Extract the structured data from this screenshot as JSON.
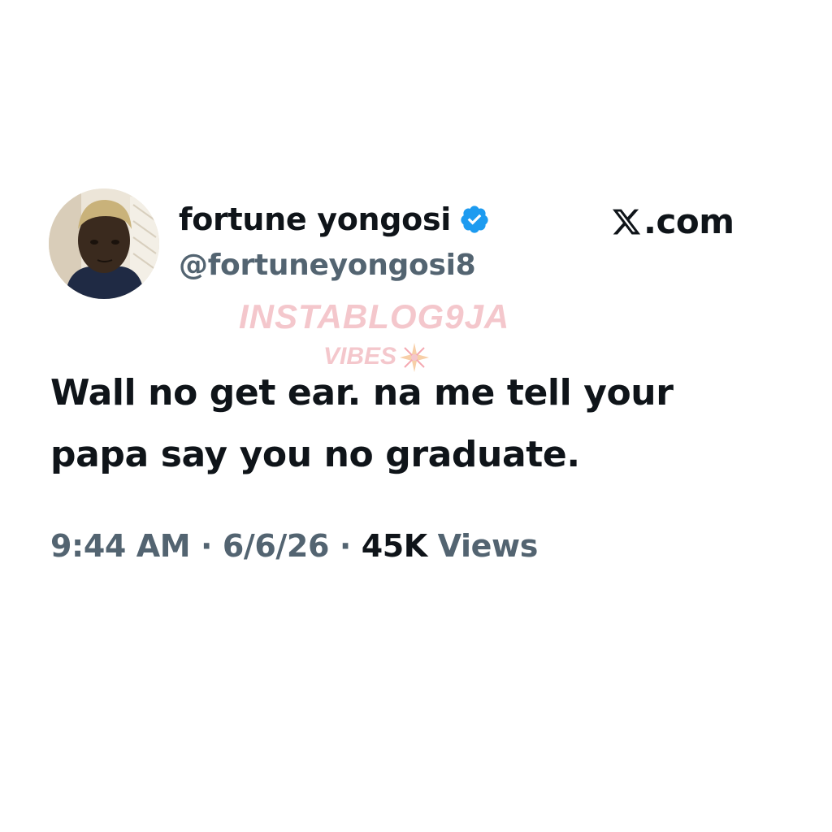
{
  "header": {
    "display_name": "fortune yongosi",
    "handle": "@fortuneyongosi8",
    "verified_icon": "verified-badge-icon",
    "avatar_icon": "profile-photo",
    "brand_text": ".com",
    "brand_icon": "x-logo-icon"
  },
  "watermark": {
    "main": "INSTABLOG9JA",
    "sub": "VIBES",
    "star_icon": "sparkle-icon"
  },
  "tweet": {
    "line1": "Wall no get ear. na me tell your",
    "line2": "papa say you no graduate."
  },
  "meta": {
    "time": "9:44 AM",
    "sep1": " · ",
    "date": "6/6/26",
    "sep2": " · ",
    "views_count": "45K",
    "views_label": " Views"
  },
  "colors": {
    "primary_text": "#0f1419",
    "secondary_text": "#536471",
    "verified_blue": "#1d9bf0",
    "watermark_pink": "#f4c7cc"
  }
}
